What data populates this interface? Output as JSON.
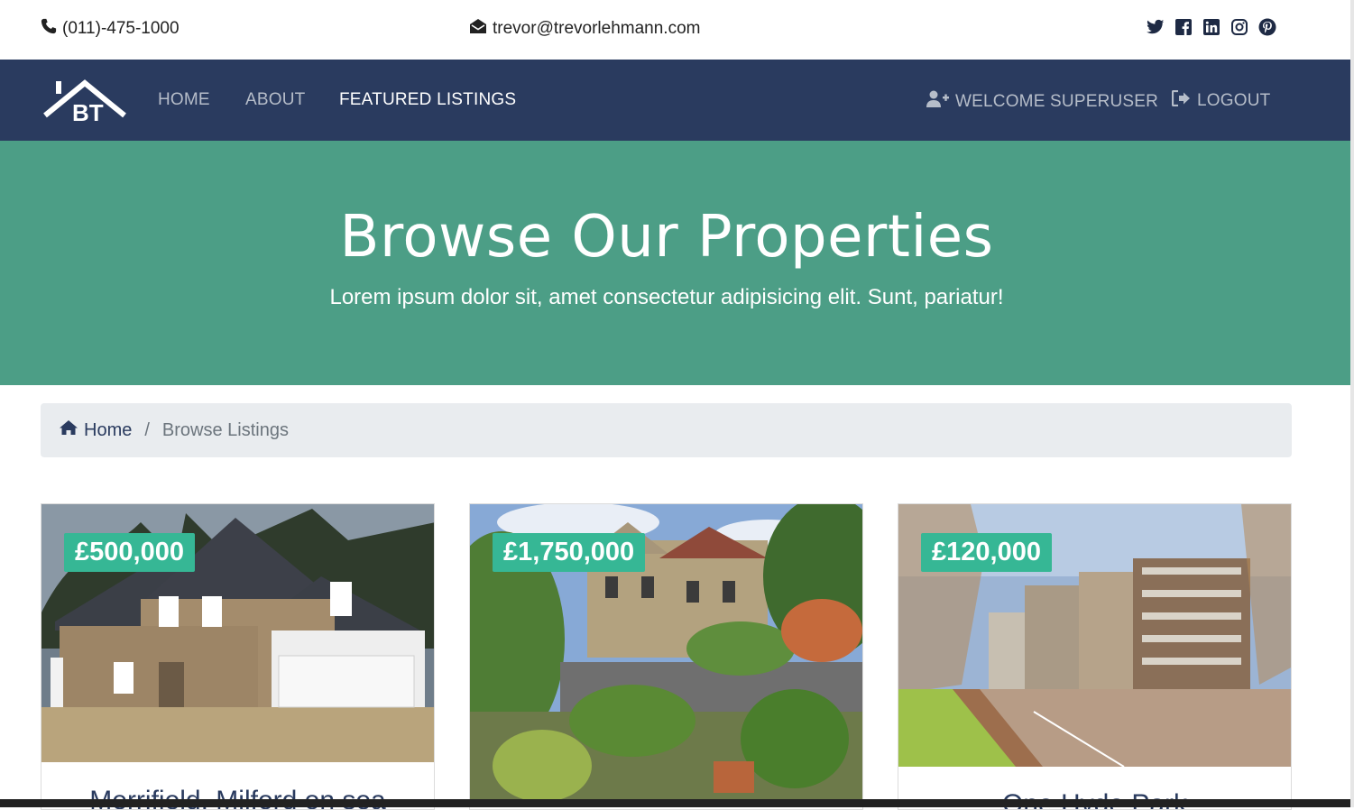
{
  "topbar": {
    "phone": "(011)-475-1000",
    "email": "trevor@trevorlehmann.com",
    "social_icons": [
      "twitter-icon",
      "facebook-icon",
      "linkedin-icon",
      "instagram-icon",
      "pinterest-icon"
    ]
  },
  "navbar": {
    "logo_text": "BT",
    "links": [
      {
        "label": "HOME",
        "active": false
      },
      {
        "label": "ABOUT",
        "active": false
      },
      {
        "label": "FEATURED LISTINGS",
        "active": true
      }
    ],
    "welcome": "WELCOME SUPERUSER",
    "logout": "LOGOUT"
  },
  "hero": {
    "title": "Browse Our Properties",
    "subtitle": "Lorem ipsum dolor sit, amet consectetur adipisicing elit. Sunt, pariatur!"
  },
  "breadcrumb": {
    "home": "Home",
    "separator": "/",
    "current": "Browse Listings"
  },
  "listings": [
    {
      "price": "£500,000",
      "title": "Merrifield, Milford on sea"
    },
    {
      "price": "£1,750,000",
      "title": ""
    },
    {
      "price": "£120,000",
      "title": "One Hyde Park"
    }
  ],
  "colors": {
    "navbar": "#2a3b5f",
    "hero": "#4c9e86",
    "price_badge": "#36b795",
    "breadcrumb_bg": "#e9ecef"
  }
}
